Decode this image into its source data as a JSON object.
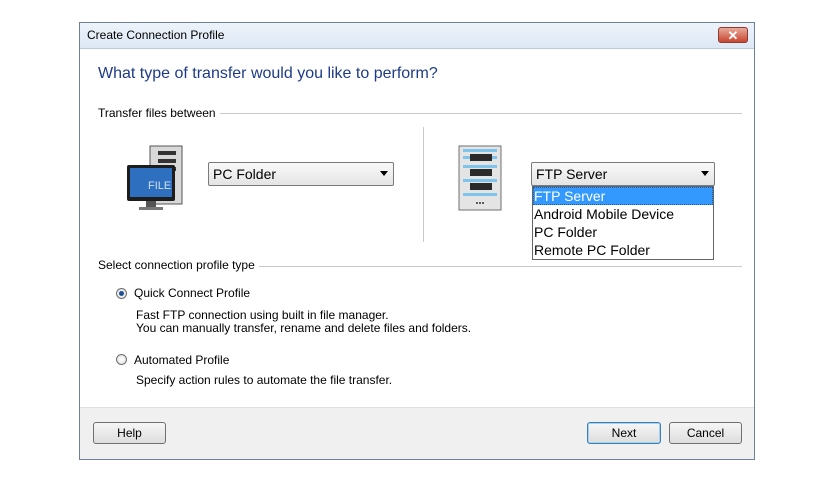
{
  "window": {
    "title": "Create Connection Profile",
    "close_glyph": "✕"
  },
  "heading": "What type of transfer would you like to perform?",
  "transfer_group": {
    "label": "Transfer files between"
  },
  "left": {
    "icon": "pc-file-icon",
    "icon_text": "FILE",
    "combo_value": "PC Folder"
  },
  "right": {
    "icon": "server-icon",
    "combo_value": "FTP Server",
    "options": [
      "FTP Server",
      "Android Mobile Device",
      "PC Folder",
      "Remote PC Folder"
    ],
    "selected_index": 0
  },
  "profile_group": {
    "label": "Select connection profile type"
  },
  "profiles": [
    {
      "label": "Quick Connect Profile",
      "selected": true,
      "desc1": "Fast FTP connection using built in file manager.",
      "desc2": "You can manually transfer, rename and delete files and folders."
    },
    {
      "label": "Automated Profile",
      "selected": false,
      "desc1": "Specify action rules to automate the file transfer."
    }
  ],
  "buttons": {
    "help": "Help",
    "next": "Next",
    "cancel": "Cancel"
  },
  "colors": {
    "heading": "#1e3b87",
    "selection": "#3399ff",
    "close": "#c7452e"
  }
}
